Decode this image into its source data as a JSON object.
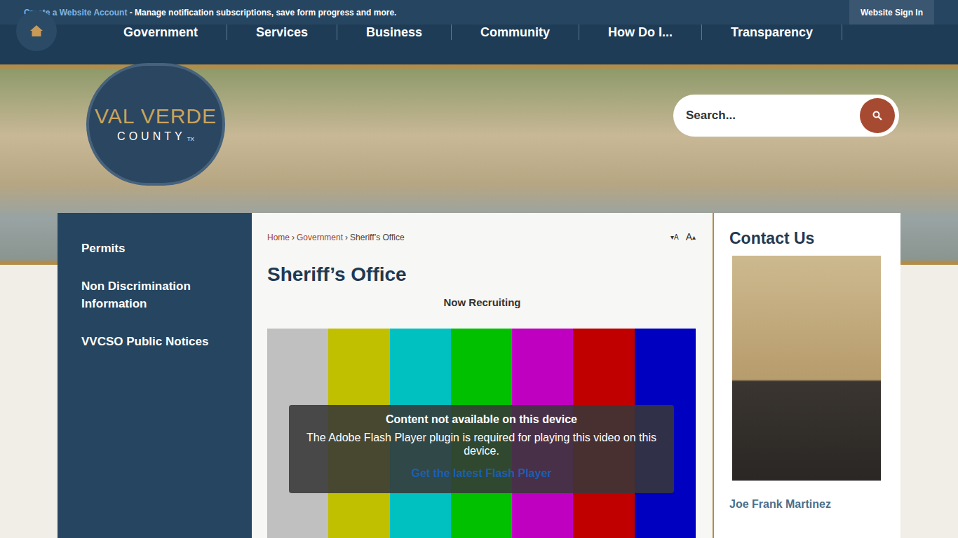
{
  "top_bar": {
    "link": "Create a Website Account",
    "text": " - Manage notification subscriptions, save form progress and more.",
    "button": "Website Sign In"
  },
  "nav": {
    "items": [
      "Government",
      "Services",
      "Business",
      "Community",
      "How Do I...",
      "Transparency"
    ]
  },
  "logo": {
    "line1": "VAL VERDE",
    "line2": "COUNTY",
    "suffix": "TX"
  },
  "search": {
    "placeholder": "Search..."
  },
  "sidebar": {
    "items": [
      "Permits",
      "Non Discrimination Information",
      "VVCSO Public Notices"
    ]
  },
  "breadcrumb": [
    {
      "label": "Home",
      "link": true
    },
    {
      "label": "›",
      "link": false
    },
    {
      "label": "Government",
      "link": true
    },
    {
      "label": "›",
      "link": false
    },
    {
      "label": "Sheriff’s Office",
      "link": false
    }
  ],
  "font_size": [
    {
      "arrow": "▾",
      "label": "A"
    },
    {
      "arrow": "▴",
      "label": "A"
    }
  ],
  "page": {
    "title": "Sheriff’s Office",
    "subtitle": "Now Recruiting"
  },
  "video": {
    "bars": [
      {
        "color": "#c0c0c0"
      },
      {
        "color": "#c0c000"
      },
      {
        "color": "#00c0c0"
      },
      {
        "color": "#00c000"
      },
      {
        "color": "#c000c0"
      },
      {
        "color": "#c00000"
      },
      {
        "color": "#0000c0"
      }
    ],
    "message": {
      "title": "Content not available on this device",
      "text": "The Adobe Flash Player plugin is required for playing this video on this device.",
      "link": "Get the latest Flash Player"
    }
  },
  "contact": {
    "title": "Contact Us",
    "name": "Joe Frank Martinez"
  }
}
